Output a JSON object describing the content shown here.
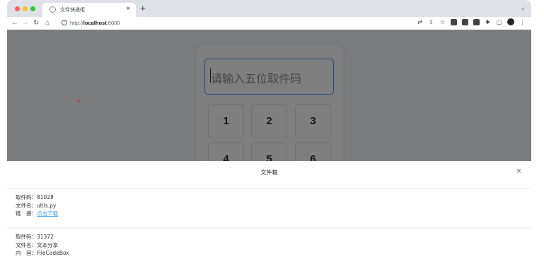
{
  "browser": {
    "tab_title": "文件快递柜",
    "tab_close": "×",
    "new_tab": "+",
    "tab_menu": "⌄",
    "url_prefix": "http://",
    "url_host": "localhost",
    "url_port": ":8000"
  },
  "page": {
    "input_placeholder": "请输入五位取件码",
    "keys": [
      "1",
      "2",
      "3",
      "4",
      "5",
      "6"
    ]
  },
  "drawer": {
    "title": "文件箱",
    "close": "×",
    "files": [
      {
        "code_label": "取件码：",
        "code": "81028",
        "name_label": "文件名：",
        "name": "utils.py",
        "link_label": "链　接：",
        "link_text": "点击下载"
      },
      {
        "code_label": "取件码：",
        "code": "31372",
        "name_label": "文件名：",
        "name": "文本分享",
        "content_label": "内　容：",
        "content": "FileCodeBox"
      }
    ]
  },
  "colors": {
    "accent": "#409eff",
    "overlay": "rgba(0,0,0,0.5)"
  }
}
